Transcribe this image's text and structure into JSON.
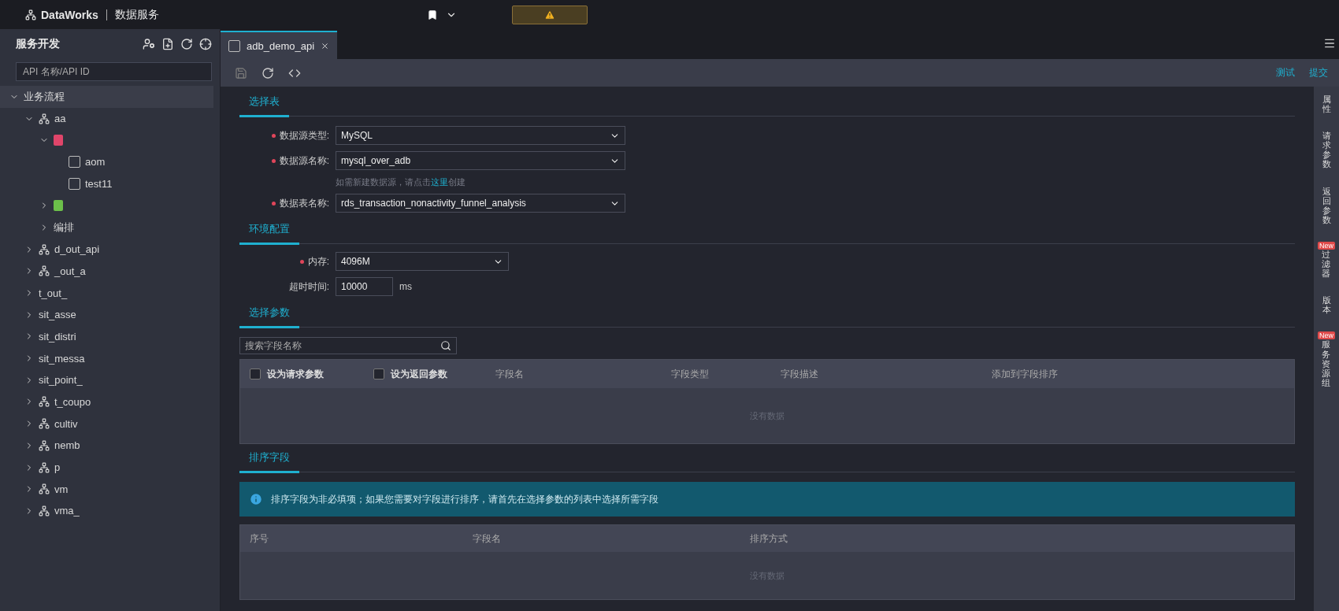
{
  "topbar": {
    "logo": "DataWorks",
    "product": "数据服务"
  },
  "sidebar": {
    "title": "服务开发",
    "search": {
      "placeholder": "API 名称/API ID"
    },
    "tree": [
      {
        "label": "业务流程",
        "kind": "root",
        "expanded": true,
        "children": [
          {
            "label": "aa",
            "kind": "folder",
            "expanded": true,
            "children": [
              {
                "kind": "group",
                "color": "#e0456a",
                "expanded": true,
                "children": [
                  {
                    "label": "aom",
                    "kind": "api"
                  },
                  {
                    "label": "test11",
                    "kind": "api"
                  }
                ]
              },
              {
                "kind": "group",
                "color": "#6cc04a",
                "expanded": false
              },
              {
                "label": "编排",
                "kind": "plain",
                "expanded": false
              }
            ]
          },
          {
            "label": "d_out_api",
            "kind": "folder",
            "expanded": false
          },
          {
            "label": "_out_a",
            "kind": "folder",
            "expanded": false
          },
          {
            "label": "t_out_",
            "kind": "plain",
            "expanded": false
          },
          {
            "label": "sit_asse",
            "kind": "plain",
            "expanded": false
          },
          {
            "label": "sit_distri",
            "kind": "plain",
            "expanded": false
          },
          {
            "label": "sit_messa",
            "kind": "plain",
            "expanded": false
          },
          {
            "label": "sit_point_",
            "kind": "plain",
            "expanded": false
          },
          {
            "label": "t_coupo",
            "kind": "folder",
            "expanded": false
          },
          {
            "label": "cultiv",
            "kind": "folder",
            "expanded": false
          },
          {
            "label": "nemb",
            "kind": "folder",
            "expanded": false
          },
          {
            "label": "p",
            "kind": "folder",
            "expanded": false
          },
          {
            "label": "vm",
            "kind": "folder",
            "expanded": false
          },
          {
            "label": "vma_",
            "kind": "folder",
            "expanded": false
          }
        ]
      }
    ]
  },
  "tabs": [
    {
      "label": "adb_demo_api",
      "selected": true
    }
  ],
  "toolbar": {
    "actions": [
      "测试",
      "提交"
    ]
  },
  "select_table": {
    "title": "选择表",
    "fields": [
      {
        "label": "数据源类型:",
        "required": true,
        "value": "MySQL"
      },
      {
        "label": "数据源名称:",
        "required": true,
        "value": "mysql_over_adb",
        "hint_before": "如需新建数据源，请点击",
        "hint_link": "这里",
        "hint_after": "创建"
      },
      {
        "label": "数据表名称:",
        "required": true,
        "value": "rds_transaction_nonactivity_funnel_analysis"
      }
    ]
  },
  "env_config": {
    "title": "环境配置",
    "memory": {
      "label": "内存:",
      "required": true,
      "value": "4096M"
    },
    "timeout": {
      "label": "超时时间:",
      "required": false,
      "value": "10000",
      "unit": "ms"
    }
  },
  "select_params": {
    "title": "选择参数",
    "search": {
      "placeholder": "搜索字段名称"
    },
    "columns": [
      {
        "label": "设为请求参数",
        "kind": "checkbox",
        "checked": false
      },
      {
        "label": "设为返回参数",
        "kind": "checkbox",
        "checked": false
      },
      {
        "label": "字段名",
        "kind": "text"
      },
      {
        "label": "字段类型",
        "kind": "text"
      },
      {
        "label": "字段描述",
        "kind": "text"
      },
      {
        "label": "添加到字段排序",
        "kind": "text"
      }
    ],
    "empty": "没有数据"
  },
  "sort_fields": {
    "title": "排序字段",
    "info": "排序字段为非必填项；如果您需要对字段进行排序，请首先在选择参数的列表中选择所需字段",
    "columns": [
      "序号",
      "字段名",
      "排序方式"
    ],
    "empty": "没有数据"
  },
  "right_panel": [
    {
      "label": "属性"
    },
    {
      "label": "请求参数"
    },
    {
      "label": "返回参数"
    },
    {
      "label": "过滤器",
      "badge": "New"
    },
    {
      "label": "版本"
    },
    {
      "label": "服务资源组",
      "badge": "New"
    }
  ]
}
